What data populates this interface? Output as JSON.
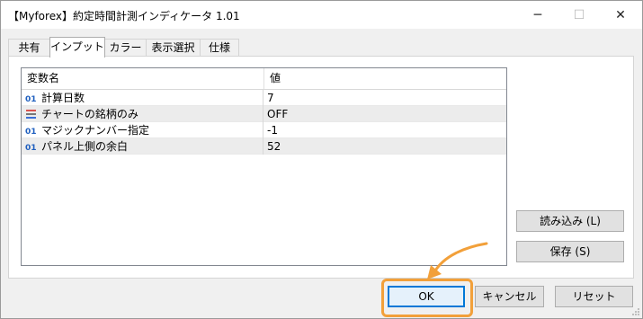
{
  "window": {
    "title": "【Myforex】約定時間計測インディケータ 1.01",
    "controls": {
      "minimize": "─",
      "maximize": "☐",
      "close": "✕"
    }
  },
  "tabs": [
    {
      "label": "共有",
      "active": false
    },
    {
      "label": "インプット",
      "active": true
    },
    {
      "label": "カラー",
      "active": false
    },
    {
      "label": "表示選択",
      "active": false
    },
    {
      "label": "仕様",
      "active": false
    }
  ],
  "table": {
    "headers": {
      "variable": "変数名",
      "value": "値"
    },
    "rows": [
      {
        "icon": "01",
        "name": "計算日数",
        "value": "7"
      },
      {
        "icon": "bool-icon",
        "name": "チャートの銘柄のみ",
        "value": "OFF"
      },
      {
        "icon": "01",
        "name": "マジックナンバー指定",
        "value": "-1"
      },
      {
        "icon": "01",
        "name": "パネル上側の余白",
        "value": "52"
      }
    ]
  },
  "side_buttons": {
    "load": "読み込み (L)",
    "save": "保存 (S)"
  },
  "footer_buttons": {
    "ok": "OK",
    "cancel": "キャンセル",
    "reset": "リセット"
  },
  "colors": {
    "accent": "#0078d7",
    "highlight": "#f2a03a",
    "int_icon": "#1f5fbf",
    "bool_icon_top": "#d9534f",
    "bool_icon_bottom": "#3a6fd8"
  }
}
